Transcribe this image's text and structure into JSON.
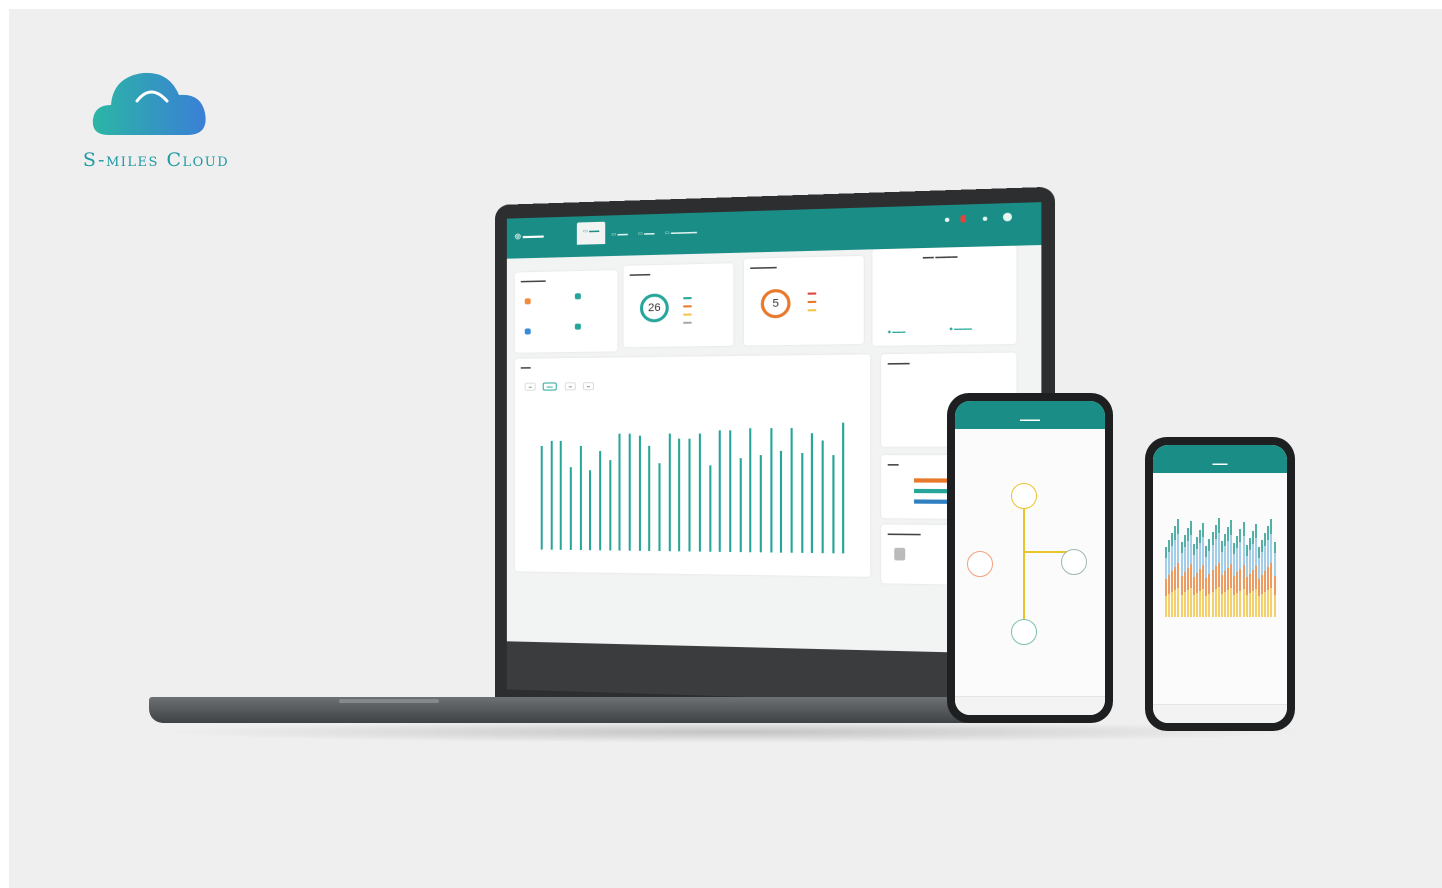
{
  "brand": {
    "logo_text": "S-miles Cloud",
    "primary_color": "#1e9aa3",
    "cloud_gradient": [
      "#2bb6a5",
      "#3a7fd6"
    ]
  },
  "dashboard": {
    "gauges": [
      {
        "value": "26",
        "color": "#26a69a"
      },
      {
        "value": "5",
        "color": "#e8782a"
      }
    ],
    "chart_values": [
      0.86,
      0.9,
      0.9,
      0.68,
      0.86,
      0.66,
      0.82,
      0.74,
      0.96,
      0.96,
      0.94,
      0.86,
      0.72,
      0.96,
      0.92,
      0.92,
      0.96,
      0.7,
      0.98,
      0.98,
      0.76,
      1.0,
      0.78,
      1.0,
      0.82,
      1.0,
      0.8,
      0.96,
      0.9,
      0.78,
      1.04
    ],
    "ranking_colors": [
      "#e8782a",
      "#26a69a",
      "#2f7fc1"
    ]
  },
  "phone_flow": {
    "node_colors": {
      "grid": "#e8c52a",
      "pv": "#f0a27d",
      "home": "#9fb8b0",
      "battery": "#7fbfb3"
    }
  },
  "phone_history": {
    "series_colors": [
      "#f2c54a",
      "#e8843a",
      "#8fc3e3",
      "#2a9d8f"
    ]
  }
}
